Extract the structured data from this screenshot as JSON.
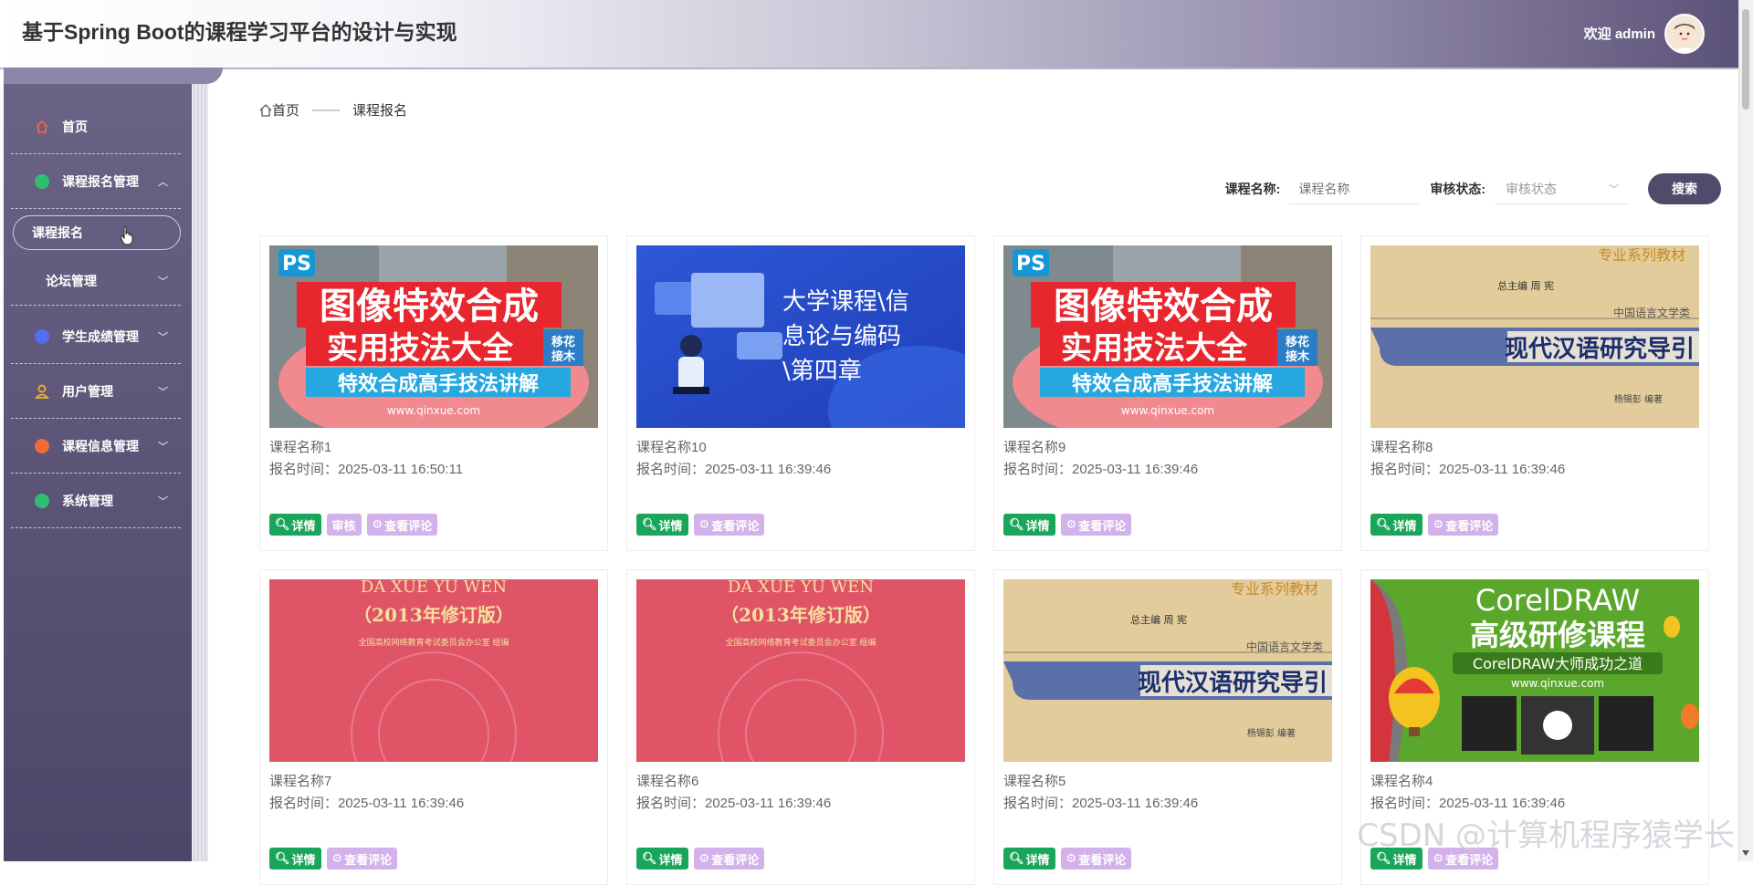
{
  "header": {
    "title": "基于Spring Boot的课程学习平台的设计与实现",
    "welcome": "欢迎 admin"
  },
  "sidebar": {
    "items": [
      {
        "label": "首页",
        "icon": "home-icon",
        "color": "#e8664a"
      },
      {
        "label": "课程报名管理",
        "icon": "circle-icon",
        "color": "#2fbf71"
      },
      {
        "label": "学生成绩管理",
        "icon": "circle-icon",
        "color": "#4f6df5"
      },
      {
        "label": "用户管理",
        "icon": "user-icon",
        "color": "#f2b51c"
      },
      {
        "label": "课程信息管理",
        "icon": "circle-icon",
        "color": "#f06a3a"
      },
      {
        "label": "系统管理",
        "icon": "circle-icon",
        "color": "#2fbf71"
      }
    ],
    "sub_active": "课程报名",
    "sub_item": "论坛管理"
  },
  "breadcrumb": {
    "home": "首页",
    "sep": "——",
    "current": "课程报名"
  },
  "search": {
    "name_label": "课程名称:",
    "name_placeholder": "课程名称",
    "status_label": "审核状态:",
    "status_placeholder": "审核状态",
    "button": "搜索"
  },
  "cards": [
    {
      "name": "课程名称1",
      "time": "报名时间：2025-03-11 16:50:11",
      "image": "ps",
      "actions": [
        "详情",
        "审核",
        "查看评论"
      ]
    },
    {
      "name": "课程名称10",
      "time": "报名时间：2025-03-11 16:39:46",
      "image": "blue",
      "actions": [
        "详情",
        "查看评论"
      ]
    },
    {
      "name": "课程名称9",
      "time": "报名时间：2025-03-11 16:39:46",
      "image": "ps",
      "actions": [
        "详情",
        "查看评论"
      ]
    },
    {
      "name": "课程名称8",
      "time": "报名时间：2025-03-11 16:39:46",
      "image": "book",
      "actions": [
        "详情",
        "查看评论"
      ]
    },
    {
      "name": "课程名称7",
      "time": "报名时间：2025-03-11 16:39:46",
      "image": "red",
      "actions": [
        "详情",
        "查看评论"
      ]
    },
    {
      "name": "课程名称6",
      "time": "报名时间：2025-03-11 16:39:46",
      "image": "red",
      "actions": [
        "详情",
        "查看评论"
      ]
    },
    {
      "name": "课程名称5",
      "time": "报名时间：2025-03-11 16:39:46",
      "image": "book",
      "actions": [
        "详情",
        "查看评论"
      ]
    },
    {
      "name": "课程名称4",
      "time": "报名时间：2025-03-11 16:39:46",
      "image": "corel",
      "actions": [
        "详情",
        "查看评论"
      ]
    }
  ],
  "cover_text": {
    "ps": {
      "badge": "PS",
      "line1": "图像特效合成",
      "line2": "实用技法大全",
      "corner": "移花接木",
      "line3": "特效合成高手技法讲解",
      "url": "www.qinxue.com"
    },
    "blue": {
      "line1": "大学课程\\信",
      "line2": "息论与编码",
      "line3": "\\第四章"
    },
    "book": {
      "top": "专业系列教材",
      "editor": "总主编  周 宪",
      "series": "中国语言文学类",
      "title": "现代汉语研究导引",
      "author": "杨锡彭  编著"
    },
    "red": {
      "line1": "DA XUE YU WEN",
      "line2": "（2013年修订版）",
      "line3": "全国高校网络教育考试委员会办公室  组编"
    },
    "corel": {
      "line1": "CorelDRAW",
      "line2": "高级研修课程",
      "line3": "CorelDRAW大师成功之道",
      "url": "www.qinxue.com"
    }
  },
  "watermark": "CSDN @计算机程序猿学长"
}
